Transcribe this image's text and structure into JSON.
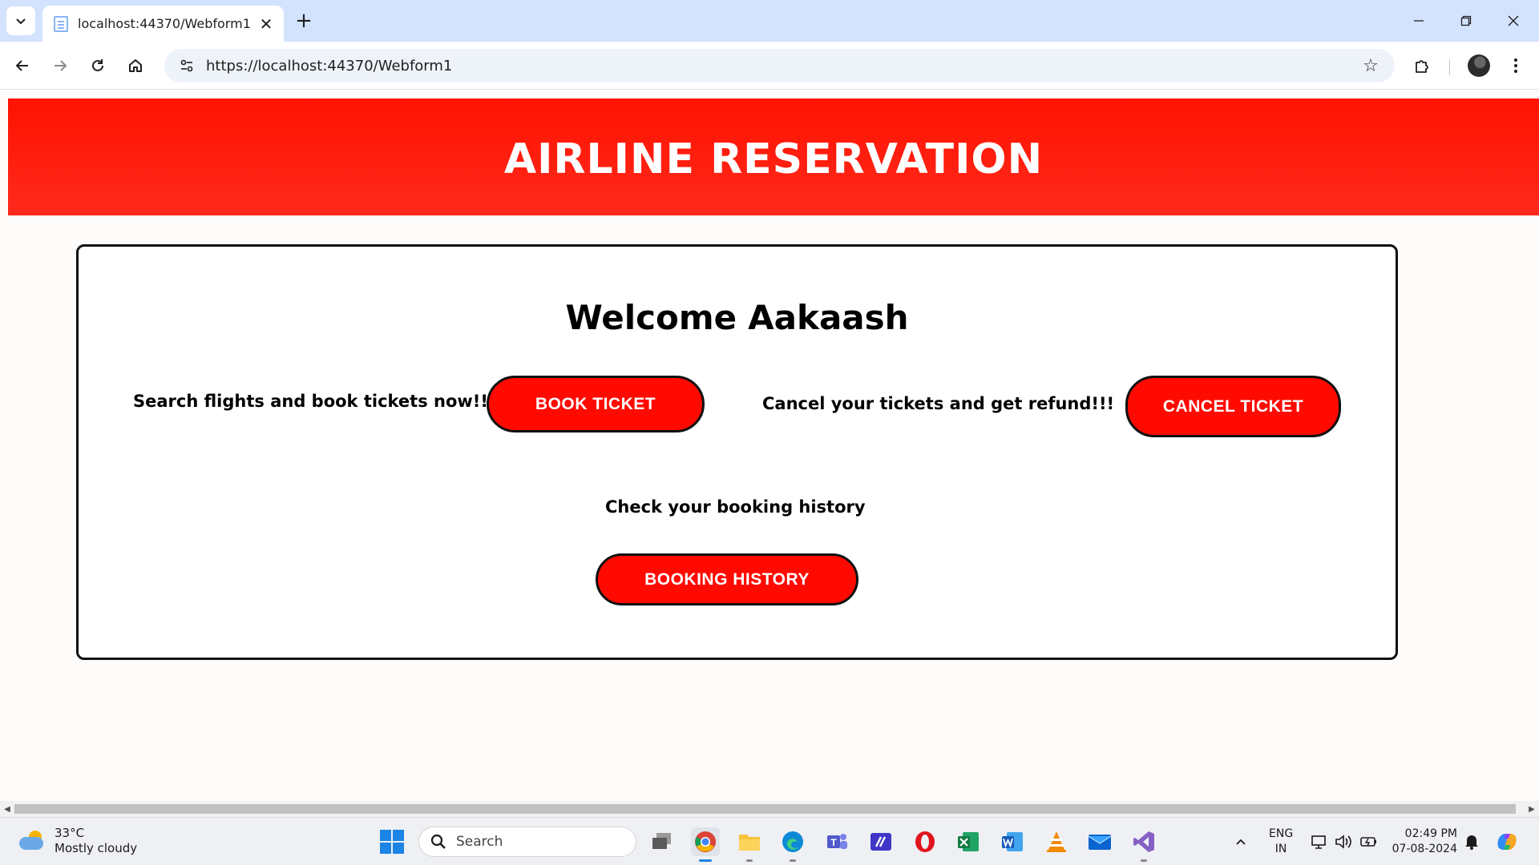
{
  "browser": {
    "tab_title": "localhost:44370/Webform1",
    "url": "https://localhost:44370/Webform1"
  },
  "page": {
    "banner_title": "AIRLINE RESERVATION",
    "welcome_prefix": "Welcome",
    "user_name": "Aakaash",
    "book_prompt": "Search flights and book tickets now!!!",
    "book_button": "BOOK TICKET",
    "cancel_prompt": "Cancel your tickets and get refund!!!",
    "cancel_button": "CANCEL TICKET",
    "history_prompt": "Check your booking history",
    "history_button": "BOOKING HISTORY"
  },
  "colors": {
    "banner_red": "#ff1200",
    "button_red": "#ff0a00",
    "tabstrip_blue": "#d3e3fd"
  },
  "taskbar": {
    "weather_temp": "33°C",
    "weather_desc": "Mostly cloudy",
    "search_placeholder": "Search",
    "language_line1": "ENG",
    "language_line2": "IN",
    "time": "02:49 PM",
    "date": "07-08-2024",
    "apps": [
      "task-view-icon",
      "chrome-icon",
      "file-explorer-icon",
      "edge-icon",
      "teams-icon",
      "dev-app-icon",
      "opera-icon",
      "excel-icon",
      "word-icon",
      "vlc-icon",
      "mail-icon",
      "visual-studio-icon"
    ]
  }
}
